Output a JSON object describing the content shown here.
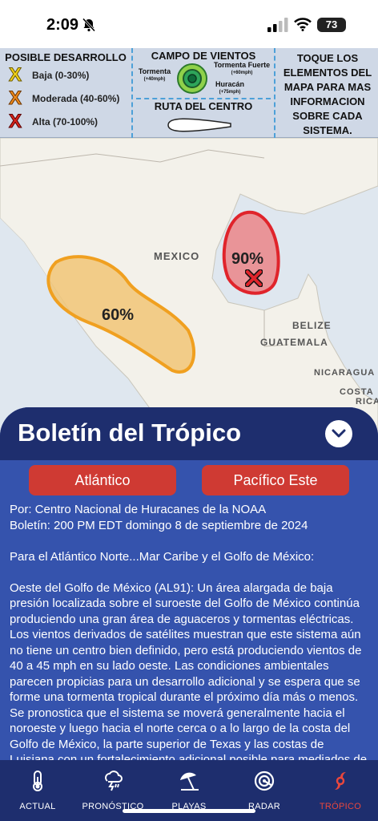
{
  "status": {
    "time": "2:09",
    "battery": "73"
  },
  "legend": {
    "development_title": "POSIBLE DESARROLLO",
    "levels": [
      {
        "mark": "X",
        "label": "Baja (0-30%)",
        "color": "#f2d21b"
      },
      {
        "mark": "X",
        "label": "Moderada (40-60%)",
        "color": "#f08a1c"
      },
      {
        "mark": "X",
        "label": "Alta (70-100%)",
        "color": "#d9241c"
      }
    ],
    "wind_title": "CAMPO DE VIENTOS",
    "storm": "Tormenta",
    "storm_speed": "(+40mph)",
    "strong_storm": "Tormenta Fuerte",
    "strong_storm_speed": "(+60mph)",
    "hurricane": "Huracán",
    "hurricane_speed": "(+75mph)",
    "route_title": "RUTA DEL CENTRO",
    "touch_note": "TOQUE LOS ELEMENTOS DEL MAPA PARA MAS INFORMACION SOBRE CADA SISTEMA."
  },
  "map": {
    "labels": {
      "mexico": "MEXICO",
      "belize": "BELIZE",
      "guatemala": "GUATEMALA",
      "nicaragua": "NICARAGUA",
      "costa": "COSTA",
      "rica": "RICA"
    },
    "systems": [
      {
        "percent": "90%",
        "level": "high",
        "color": "#e0242b"
      },
      {
        "percent": "60%",
        "level": "moderate",
        "color": "#f0a020"
      }
    ]
  },
  "bulletin": {
    "title": "Boletín del Trópico",
    "tabs": [
      "Atlántico",
      "Pacífico Este"
    ],
    "by_line": "Por: Centro Nacional de Huracanes de la NOAA",
    "issued_line": "Boletín: 200 PM EDT domingo 8 de septiembre de 2024",
    "region": "Para el Atlántico Norte...Mar Caribe y el Golfo de México:",
    "body": "Oeste del Golfo de México (AL91): Un área alargada de baja presión localizada sobre el suroeste del Golfo de México continúa produciendo una gran área de aguaceros y tormentas eléctricas. Los vientos derivados de satélites muestran que este sistema aún no tiene un centro bien definido, pero está produciendo vientos de 40 a 45 mph en su lado oeste. Las condiciones ambientales parecen propicias para un desarrollo adicional y se espera que se forme una tormenta tropical durante el próximo día más o menos. Se pronostica que el sistema se moverá generalmente hacia el noroeste y luego hacia el norte cerca o a lo largo de la costa del Golfo de México, la parte superior de Texas y las costas de Luisiana con un fortalecimiento adicional posible para mediados de esta"
  },
  "nav": {
    "items": [
      {
        "label": "ACTUAL",
        "icon": "thermometer-icon"
      },
      {
        "label": "PRONÓSTICO",
        "icon": "forecast-storm-icon"
      },
      {
        "label": "PLAYAS",
        "icon": "beach-umbrella-icon"
      },
      {
        "label": "RADAR",
        "icon": "radar-icon"
      },
      {
        "label": "TRÓPICO",
        "icon": "hurricane-icon"
      }
    ],
    "active_color": "#e8473d"
  }
}
